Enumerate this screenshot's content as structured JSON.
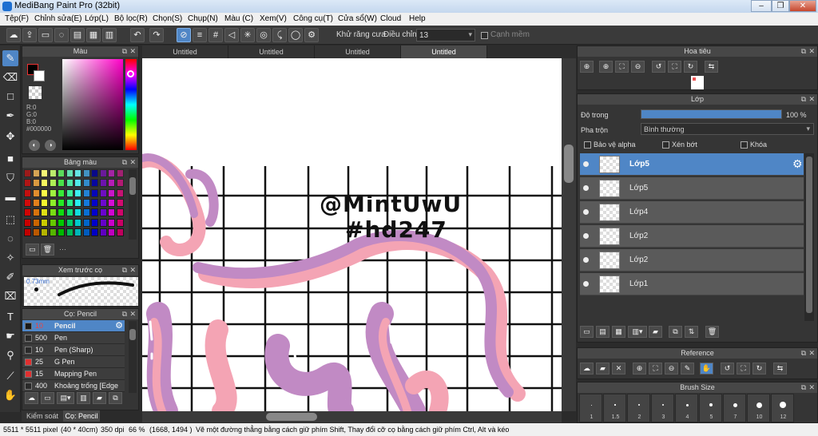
{
  "window": {
    "title": "MediBang Paint Pro (32bit)",
    "controls": [
      "–",
      "❐",
      "✕"
    ]
  },
  "menu": [
    "Tệp(F)",
    "Chỉnh sửa(E)",
    "Lớp(L)",
    "Bộ lọc(R)",
    "Chọn(S)",
    "Chụp(N)",
    "Màu (C)",
    "Xem(V)",
    "Công cụ(T)",
    "Cửa sổ(W)",
    "Cloud",
    "Help"
  ],
  "toolbar": {
    "antialias_label": "Khử răng cưa",
    "adjust_label": "Điều chỉnh",
    "adjust_value": "13",
    "smooth_label": "Cạnh mềm"
  },
  "color_panel": {
    "title": "Màu",
    "r": "R:0",
    "g": "G:0",
    "b": "B:0",
    "hex": "#000000"
  },
  "palette_panel": {
    "title": "Bảng màu",
    "more": "···"
  },
  "preview_panel": {
    "title": "Xem trước cọ",
    "size": "0.73mm"
  },
  "brush_panel": {
    "title": "Cọ: Pencil",
    "brushes": [
      {
        "size": "10",
        "name": "Pencil",
        "color": "#1a1a1a",
        "selected": true
      },
      {
        "size": "500",
        "name": "Pen",
        "color": "#2a2a2a",
        "selected": false
      },
      {
        "size": "10",
        "name": "Pen (Sharp)",
        "color": "#2a2a2a",
        "selected": false
      },
      {
        "size": "25",
        "name": "G Pen",
        "color": "#e03030",
        "selected": false
      },
      {
        "size": "15",
        "name": "Mapping Pen",
        "color": "#e03030",
        "selected": false
      },
      {
        "size": "400",
        "name": "Khoảng trống [Edge",
        "color": "#2a2a2a",
        "selected": false
      }
    ]
  },
  "bottom_tabs": {
    "tab1": "Kiểm soát cọ",
    "tab2": "Cọ: Pencil"
  },
  "canvas_tabs": [
    "Untitled",
    "Untitled",
    "Untitled",
    "Untitled"
  ],
  "canvas_text": {
    "line1": "@MintUwU",
    "line2": "#hd247"
  },
  "navigator": {
    "title": "Hoa tiêu"
  },
  "layer_panel": {
    "title": "Lớp",
    "opacity_label": "Độ trong",
    "opacity_value": "100 %",
    "opacity_fraction": 1.0,
    "blend_label": "Pha trộn",
    "blend_value": "Bình thường",
    "protect_alpha": "Bảo vệ alpha",
    "clipping": "Xén bớt",
    "lock": "Khóa",
    "layers": [
      "Lớp5",
      "Lớp5",
      "Lớp4",
      "Lớp2",
      "Lớp2",
      "Lớp1"
    ]
  },
  "reference_panel": {
    "title": "Reference"
  },
  "brushsize_panel": {
    "title": "Brush Size",
    "sizes": [
      "1",
      "1.5",
      "2",
      "3",
      "4",
      "5",
      "7",
      "10",
      "12"
    ]
  },
  "status": {
    "dims": "5511 * 5511 pixel",
    "cm": "(40 * 40cm)",
    "dpi": "350 dpi",
    "zoom": "66 %",
    "coords": "(1668, 1494 )",
    "hint": "Vẽ một đường thẳng bằng cách giữ phím Shift, Thay đổi cỡ cọ bằng cách giữ phím Ctrl, Alt và kéo"
  },
  "colors": {
    "accent": "#4f86c6",
    "stroke_pink": "#f4a4b4",
    "stroke_purple": "#c18ac4"
  }
}
